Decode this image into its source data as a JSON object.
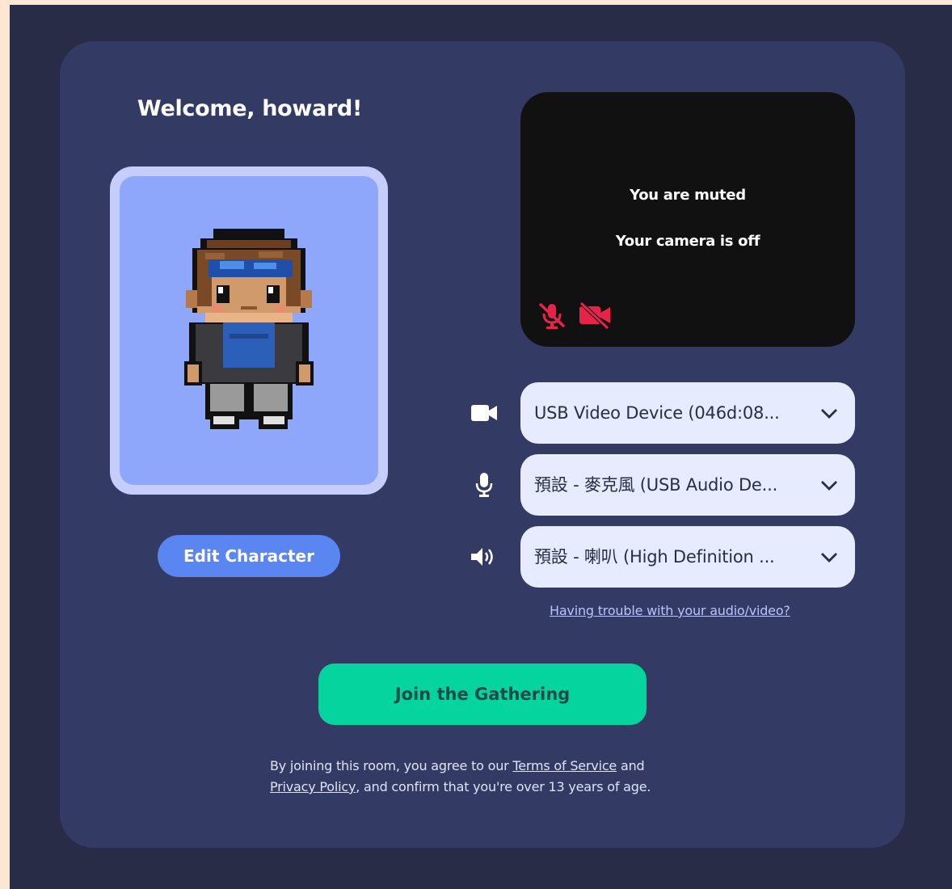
{
  "welcome": "Welcome, howard!",
  "edit_character_label": "Edit Character",
  "preview": {
    "muted_text": "You are muted",
    "camera_text": "Your camera is off"
  },
  "devices": {
    "camera": "USB Video Device (046d:08...",
    "microphone": "預設 - 麥克風 (USB Audio De...",
    "speaker": "預設 - 喇叭 (High Definition ..."
  },
  "trouble_link": "Having trouble with your audio/video?",
  "join_label": "Join the Gathering",
  "legal": {
    "prefix": "By joining this room, you agree to our ",
    "terms": "Terms of Service",
    "and": " and",
    "privacy": "Privacy Policy",
    "suffix": ", and confirm that you're over 13 years of age."
  },
  "colors": {
    "page_border": "#fde6d2",
    "background": "#282c47",
    "card": "#333a64",
    "avatar_frame": "#c5cdfb",
    "avatar_bg": "#8fa7fb",
    "edit_button": "#5a86f2",
    "join_button": "#06d49f",
    "preview_bg": "#111111",
    "muted_red": "#e8234a",
    "select_bg": "#e6ebfd"
  },
  "icons": [
    "camera-icon",
    "microphone-icon",
    "speaker-icon",
    "mic-off-icon",
    "camera-off-icon",
    "chevron-down-icon"
  ]
}
